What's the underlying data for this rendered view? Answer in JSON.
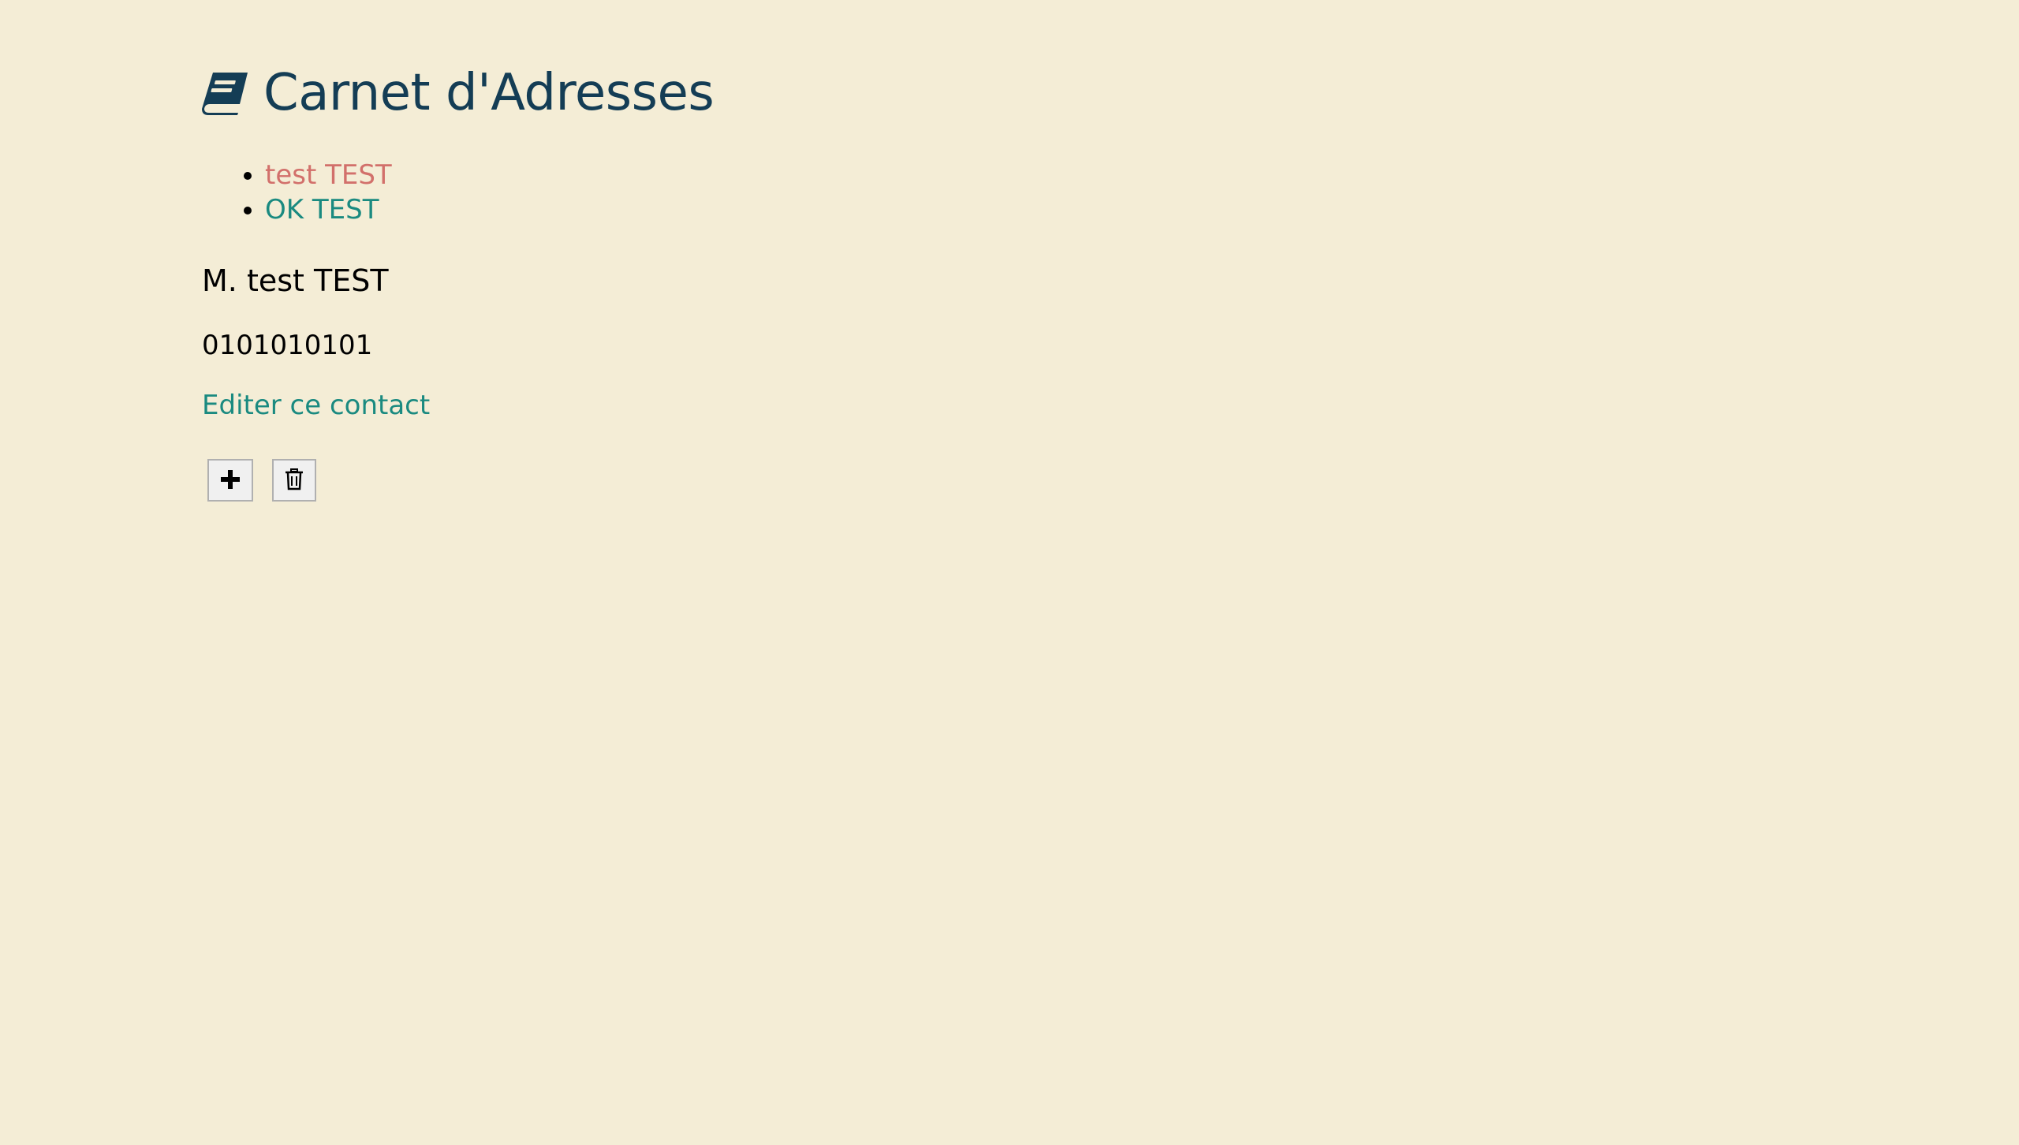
{
  "header": {
    "icon": "book-icon",
    "title": "Carnet d'Adresses"
  },
  "contacts": [
    {
      "label": "test TEST",
      "selected": true
    },
    {
      "label": "OK TEST",
      "selected": false
    }
  ],
  "detail": {
    "name": "M. test TEST",
    "phone": "0101010101",
    "edit_label": "Editer ce contact"
  },
  "actions": {
    "add_icon": "plus-icon",
    "delete_icon": "trash-icon"
  },
  "colors": {
    "background": "#f4edd6",
    "title": "#143d55",
    "link": "#1a8a80",
    "selected_link": "#d2706b"
  }
}
